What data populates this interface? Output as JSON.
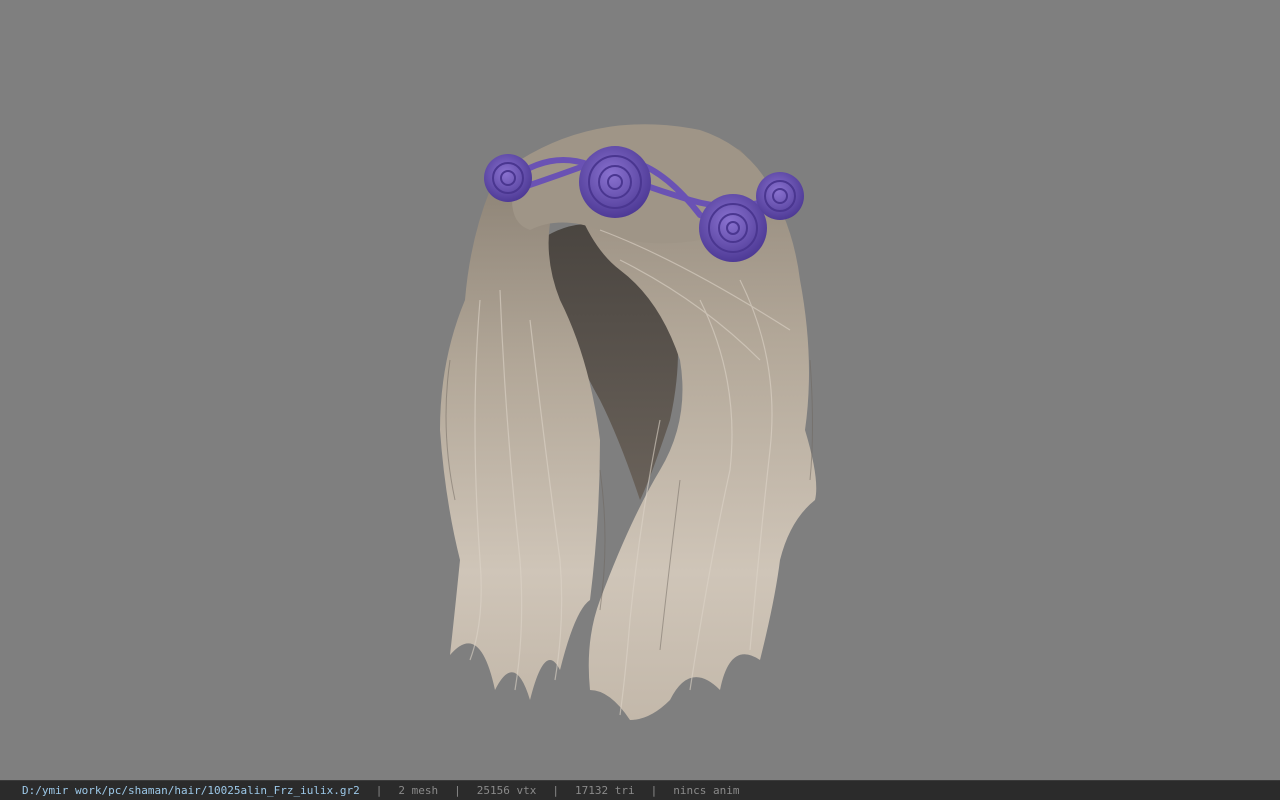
{
  "viewport": {
    "background": "#7f7f7f",
    "model": {
      "name": "hair-mesh-with-flower-crown",
      "hair_color": "#bdb2a4",
      "flower_color": "#6f56b8"
    }
  },
  "statusbar": {
    "file_path": "D:/ymir work/pc/shaman/hair/10025alin_Frz_iulix.gr2",
    "separator": "|",
    "mesh_count": "2 mesh",
    "vertex_count": "25156 vtx",
    "triangle_count": "17132 tri",
    "anim_info": "nincs anim"
  }
}
